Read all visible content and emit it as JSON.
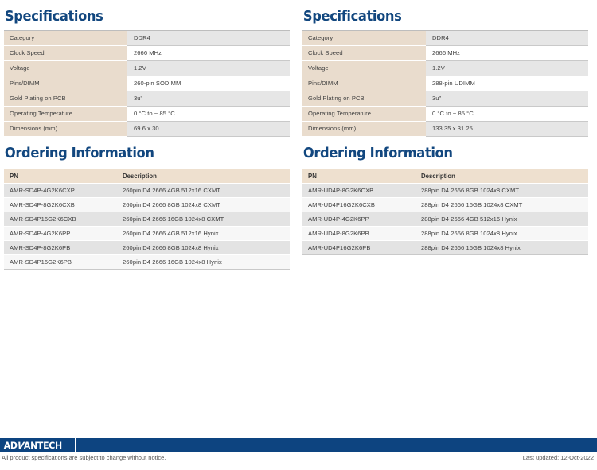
{
  "columns": [
    {
      "spec_title": "Specifications",
      "spec_rows": [
        {
          "label": "Category",
          "value": "DDR4"
        },
        {
          "label": "Clock Speed",
          "value": "2666 MHz"
        },
        {
          "label": "Voltage",
          "value": "1.2V"
        },
        {
          "label": "Pins/DIMM",
          "value": "260-pin SODIMM"
        },
        {
          "label": "Gold Plating on PCB",
          "value": "3u\""
        },
        {
          "label": "Operating Temperature",
          "value": "0 °C to ~ 85 °C"
        },
        {
          "label": "Dimensions (mm)",
          "value": "69.6 x 30"
        }
      ],
      "order_title": "Ordering Information",
      "order_headers": {
        "pn": "PN",
        "desc": "Description"
      },
      "order_rows": [
        {
          "pn": "AMR-SD4P-4G2K6CXP",
          "desc": "260pin D4 2666 4GB  512x16 CXMT"
        },
        {
          "pn": "AMR-SD4P-8G2K6CXB",
          "desc": "260pin D4 2666 8GB 1024x8 CXMT"
        },
        {
          "pn": "AMR-SD4P16G2K6CXB",
          "desc": "260pin D4 2666 16GB 1024x8 CXMT"
        },
        {
          "pn": "AMR-SD4P-4G2K6PP",
          "desc": "260pin D4 2666 4GB 512x16 Hynix"
        },
        {
          "pn": "AMR-SD4P-8G2K6PB",
          "desc": "260pin D4 2666 8GB 1024x8 Hynix"
        },
        {
          "pn": "AMR-SD4P16G2K6PB",
          "desc": "260pin D4 2666 16GB 1024x8 Hynix"
        }
      ]
    },
    {
      "spec_title": "Specifications",
      "spec_rows": [
        {
          "label": "Category",
          "value": "DDR4"
        },
        {
          "label": "Clock Speed",
          "value": "2666 MHz"
        },
        {
          "label": "Voltage",
          "value": "1.2V"
        },
        {
          "label": "Pins/DIMM",
          "value": "288-pin UDIMM"
        },
        {
          "label": "Gold Plating on PCB",
          "value": "3u\""
        },
        {
          "label": "Operating Temperature",
          "value": "0 °C to ~ 85 °C"
        },
        {
          "label": "Dimensions (mm)",
          "value": "133.35 x 31.25"
        }
      ],
      "order_title": "Ordering Information",
      "order_headers": {
        "pn": "PN",
        "desc": "Description"
      },
      "order_rows": [
        {
          "pn": "AMR-UD4P-8G2K6CXB",
          "desc": "288pin D4 2666 8GB 1024x8 CXMT"
        },
        {
          "pn": "AMR-UD4P16G2K6CXB",
          "desc": "288pin D4 2666 16GB 1024x8 CXMT"
        },
        {
          "pn": "AMR-UD4P-4G2K6PP",
          "desc": "288pin D4 2666 4GB 512x16 Hynix"
        },
        {
          "pn": "AMR-UD4P-8G2K6PB",
          "desc": "288pin D4 2666 8GB 1024x8 Hynix"
        },
        {
          "pn": "AMR-UD4P16G2K6PB",
          "desc": "288pin D4 2666 16GB 1024x8 Hynix"
        }
      ]
    }
  ],
  "footer": {
    "logo_part1": "AD",
    "logo_slant": "V",
    "logo_part2": "ANTECH",
    "note": "All product specifications are subject to change without notice.",
    "last_updated": "Last updated: 12-Oct-2022"
  },
  "colors": {
    "heading_blue": "#12477f",
    "footer_blue": "#0d4480",
    "label_tan": "#e9dccd",
    "header_tan": "#eee0cf",
    "row_gray": "#e3e3e3",
    "row_white": "#f7f7f7"
  }
}
